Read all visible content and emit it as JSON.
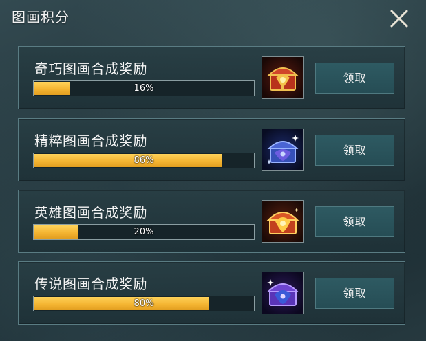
{
  "panel": {
    "title": "图画积分"
  },
  "rewards": [
    {
      "name": "奇巧图画合成奖励",
      "progress": 0.16,
      "progress_text": "16%",
      "claim_label": "领取",
      "chest_icon": "red-treasure-chest-icon",
      "chest_color": "#c84a2a"
    },
    {
      "name": "精粹图画合成奖励",
      "progress": 0.86,
      "progress_text": "86%",
      "claim_label": "领取",
      "chest_icon": "blue-treasure-chest-icon",
      "chest_color": "#3a5fd0"
    },
    {
      "name": "英雄图画合成奖励",
      "progress": 0.2,
      "progress_text": "20%",
      "claim_label": "领取",
      "chest_icon": "gold-red-treasure-chest-icon",
      "chest_color": "#d85a28"
    },
    {
      "name": "传说图画合成奖励",
      "progress": 0.8,
      "progress_text": "80%",
      "claim_label": "领取",
      "chest_icon": "purple-treasure-chest-icon",
      "chest_color": "#6a3ec8"
    }
  ],
  "colors": {
    "progress_fill": "#f4b532",
    "button_bg": "#2a535b",
    "card_border": "#5a7c83"
  }
}
